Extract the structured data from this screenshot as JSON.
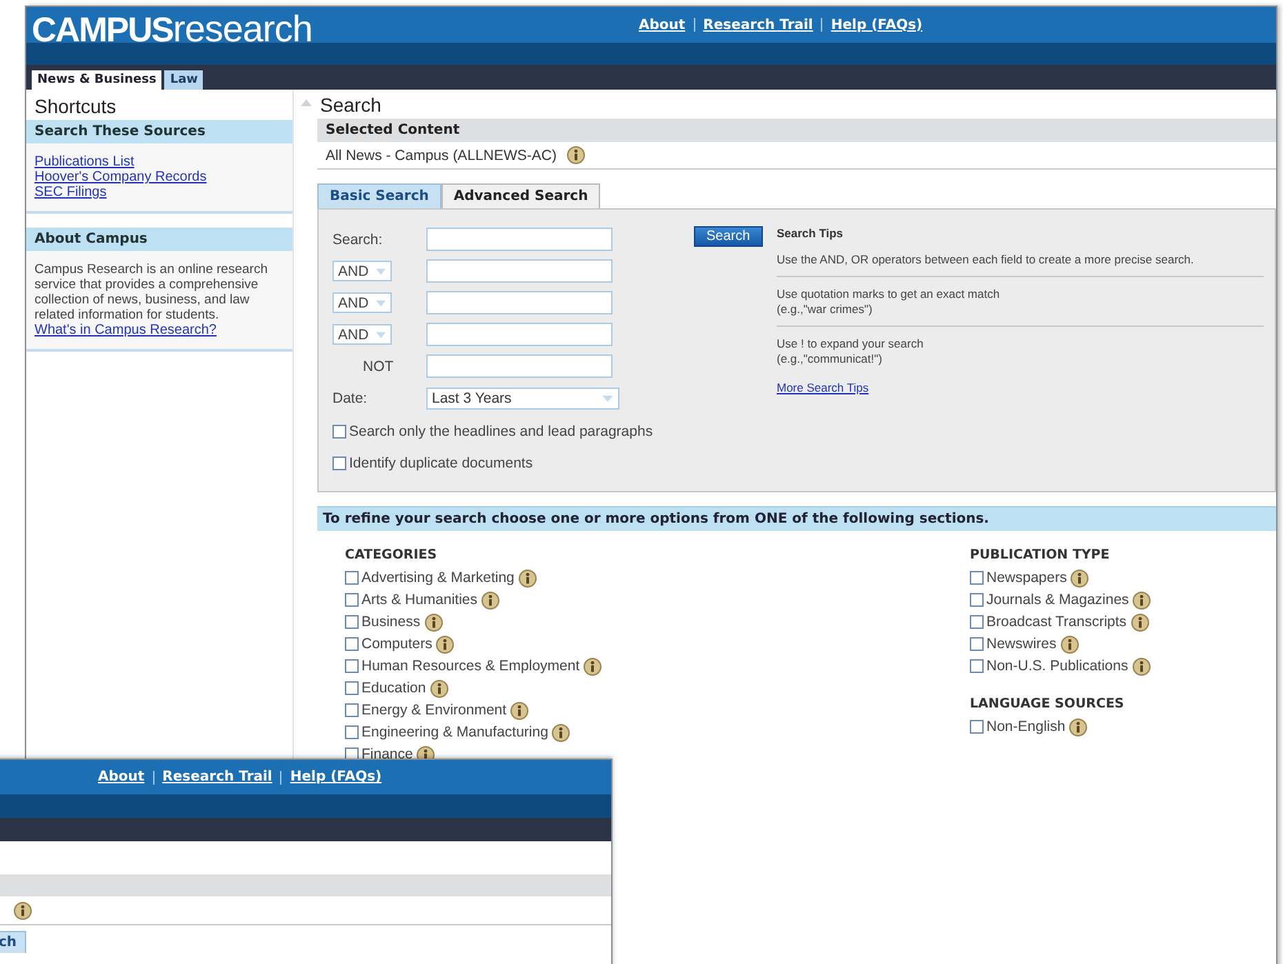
{
  "main_window": {
    "header": {
      "logo_bold": "CAMPUS",
      "logo_light": "research",
      "links": [
        "About",
        "Research Trail",
        "Help (FAQs)"
      ]
    },
    "tabs": [
      {
        "label": "News & Business",
        "selected": true
      },
      {
        "label": "Law",
        "selected": false
      }
    ],
    "sidebar": {
      "title": "Shortcuts",
      "sections": [
        {
          "heading": "Search These Sources",
          "links": [
            "Publications List",
            "Hoover's Company Records",
            "SEC Filings"
          ]
        },
        {
          "heading": "About Campus",
          "text": "Campus Research is an online research service that provides a comprehensive collection of news, business, and law related information for students.",
          "links": [
            "What's in Campus Research?"
          ]
        }
      ]
    },
    "content": {
      "title": "Search",
      "selected_content": {
        "heading": "Selected Content",
        "value": "All News - Campus (ALLNEWS-AC)"
      },
      "search_tabs": [
        {
          "label": "Basic Search",
          "selected": false
        },
        {
          "label": "Advanced Search",
          "selected": true
        }
      ],
      "form": {
        "rows": [
          {
            "kind": "label",
            "label": "Search:"
          },
          {
            "kind": "operator",
            "operator": "AND"
          },
          {
            "kind": "operator",
            "operator": "AND"
          },
          {
            "kind": "operator",
            "operator": "AND"
          },
          {
            "kind": "fixed",
            "label": "NOT"
          }
        ],
        "date": {
          "label": "Date:",
          "value": "Last 3 Years"
        },
        "search_button": "Search",
        "options": [
          {
            "label": "Search only the headlines and lead paragraphs",
            "checked": false
          },
          {
            "label": "Identify duplicate documents",
            "checked": false
          }
        ]
      },
      "tips": {
        "title": "Search Tips",
        "items": [
          {
            "lines": [
              "Use the AND, OR operators between each field to create a more precise search."
            ]
          },
          {
            "lines": [
              "Use quotation marks to get an exact match",
              "(e.g.,\"war crimes\")"
            ]
          },
          {
            "lines": [
              "Use ! to expand your search",
              "(e.g.,\"communicat!\")"
            ]
          }
        ],
        "more_link": "More Search Tips"
      },
      "refine": {
        "instruction": "To refine your search choose one or more options from ONE of the following sections.",
        "columns": [
          {
            "sections": [
              {
                "heading": "CATEGORIES",
                "items": [
                  {
                    "label": "Advertising & Marketing",
                    "checked": false
                  },
                  {
                    "label": "Arts & Humanities",
                    "checked": false
                  },
                  {
                    "label": "Business",
                    "checked": false
                  },
                  {
                    "label": "Computers",
                    "checked": false
                  },
                  {
                    "label": "Human Resources & Employment",
                    "checked": false
                  },
                  {
                    "label": "Education",
                    "checked": false
                  },
                  {
                    "label": "Energy & Environment",
                    "checked": false
                  },
                  {
                    "label": "Engineering & Manufacturing",
                    "checked": false
                  },
                  {
                    "label": "Finance",
                    "checked": false
                  }
                ]
              }
            ]
          },
          {
            "sections": [
              {
                "heading": "PUBLICATION TYPE",
                "items": [
                  {
                    "label": "Newspapers",
                    "checked": false
                  },
                  {
                    "label": "Journals & Magazines",
                    "checked": false
                  },
                  {
                    "label": "Broadcast Transcripts",
                    "checked": false
                  },
                  {
                    "label": "Newswires",
                    "checked": false
                  },
                  {
                    "label": "Non-U.S. Publications",
                    "checked": false
                  }
                ]
              },
              {
                "heading": "LANGUAGE SOURCES",
                "items": [
                  {
                    "label": "Non-English",
                    "checked": false
                  }
                ]
              }
            ]
          }
        ]
      }
    }
  },
  "front_window": {
    "links": [
      "About",
      "Research Trail",
      "Help (FAQs)"
    ],
    "tab_fragment": "ch"
  }
}
